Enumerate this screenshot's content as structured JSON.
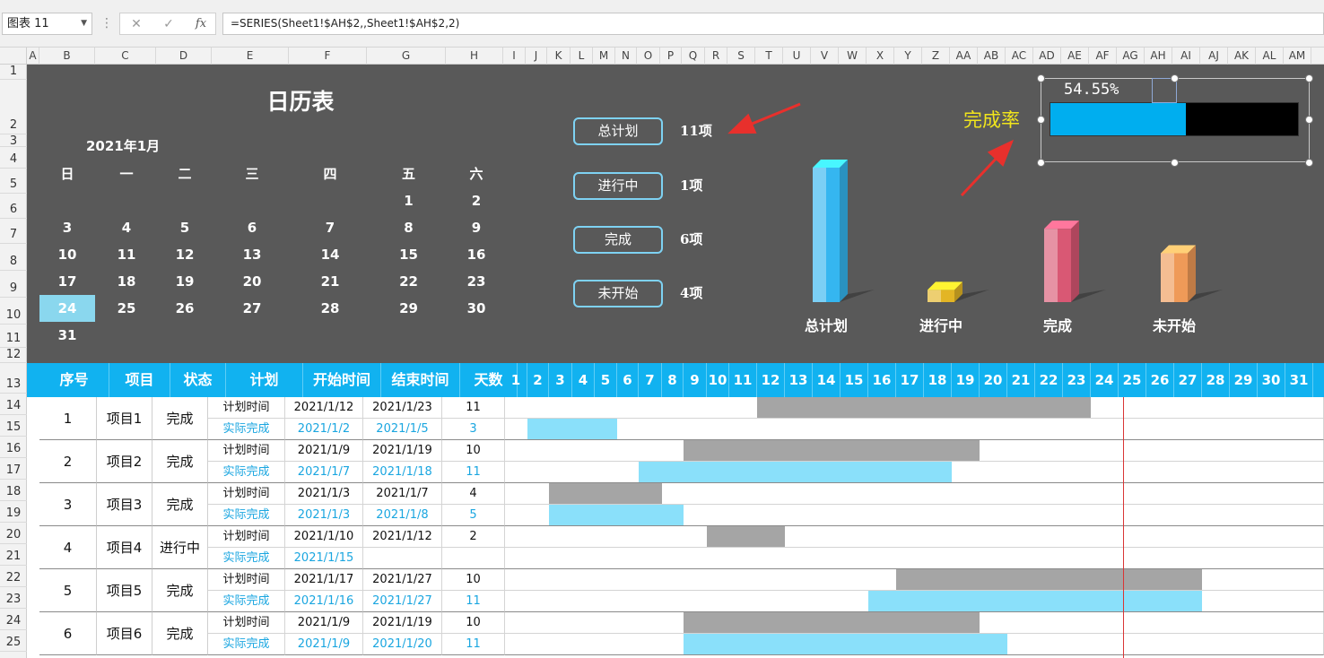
{
  "formula_bar": {
    "name_box": "图表 11",
    "formula": "=SERIES(Sheet1!$AH$2,,Sheet1!$AH$2,2)",
    "cancel_icon": "✕",
    "enter_icon": "✓",
    "fx_label": "fx"
  },
  "columns": [
    "A",
    "B",
    "C",
    "D",
    "E",
    "F",
    "G",
    "H",
    "I",
    "J",
    "K",
    "L",
    "M",
    "N",
    "O",
    "P",
    "Q",
    "R",
    "S",
    "T",
    "U",
    "V",
    "W",
    "X",
    "Y",
    "Z",
    "AA",
    "AB",
    "AC",
    "AD",
    "AE",
    "AF",
    "AG",
    "AH",
    "AI",
    "AJ",
    "AK",
    "AL",
    "AM"
  ],
  "rows": [
    "1",
    "2",
    "3",
    "4",
    "5",
    "6",
    "7",
    "8",
    "9",
    "10",
    "11",
    "12",
    "13",
    "14",
    "15",
    "16",
    "17",
    "18",
    "19",
    "20",
    "21",
    "22",
    "23",
    "24",
    "25"
  ],
  "calendar": {
    "title": "日历表",
    "month": "2021年1月",
    "weekdays": [
      "日",
      "一",
      "二",
      "三",
      "四",
      "五",
      "六"
    ],
    "weeks": [
      [
        "",
        "",
        "",
        "",
        "",
        "1",
        "2"
      ],
      [
        "3",
        "4",
        "5",
        "6",
        "7",
        "8",
        "9"
      ],
      [
        "10",
        "11",
        "12",
        "13",
        "14",
        "15",
        "16"
      ],
      [
        "17",
        "18",
        "19",
        "20",
        "21",
        "22",
        "23"
      ],
      [
        "24",
        "25",
        "26",
        "27",
        "28",
        "29",
        "30"
      ],
      [
        "31",
        "",
        "",
        "",
        "",
        "",
        ""
      ]
    ],
    "highlight": "24"
  },
  "stats": [
    {
      "label": "总计划",
      "value": "11项"
    },
    {
      "label": "进行中",
      "value": "1项"
    },
    {
      "label": "完成",
      "value": "6项"
    },
    {
      "label": "未开始",
      "value": "4项"
    }
  ],
  "chart_data": {
    "type": "bar",
    "categories": [
      "总计划",
      "进行中",
      "完成",
      "未开始"
    ],
    "values": [
      11,
      1,
      6,
      4
    ],
    "colors": [
      "#35b6f0",
      "#e3b525",
      "#d95874",
      "#ef9a58"
    ]
  },
  "completion": {
    "label": "完成率",
    "text": "54.55%",
    "value": 0.5455,
    "fill_color": "#00aeef"
  },
  "table_header": {
    "cols": [
      "序号",
      "项目",
      "状态",
      "计划",
      "开始时间",
      "结束时间",
      "天数"
    ],
    "days": [
      "1",
      "2",
      "3",
      "4",
      "5",
      "6",
      "7",
      "8",
      "9",
      "10",
      "11",
      "12",
      "13",
      "14",
      "15",
      "16",
      "17",
      "18",
      "19",
      "20",
      "21",
      "22",
      "23",
      "24",
      "25",
      "26",
      "27",
      "28",
      "29",
      "30",
      "31"
    ]
  },
  "projects": [
    {
      "no": "1",
      "name": "项目1",
      "status": "完成",
      "plan": {
        "label": "计划时间",
        "start": "2021/1/12",
        "end": "2021/1/23",
        "days": "11"
      },
      "actual": {
        "label": "实际完成",
        "start": "2021/1/2",
        "end": "2021/1/5",
        "days": "3"
      }
    },
    {
      "no": "2",
      "name": "项目2",
      "status": "完成",
      "plan": {
        "label": "计划时间",
        "start": "2021/1/9",
        "end": "2021/1/19",
        "days": "10"
      },
      "actual": {
        "label": "实际完成",
        "start": "2021/1/7",
        "end": "2021/1/18",
        "days": "11"
      }
    },
    {
      "no": "3",
      "name": "项目3",
      "status": "完成",
      "plan": {
        "label": "计划时间",
        "start": "2021/1/3",
        "end": "2021/1/7",
        "days": "4"
      },
      "actual": {
        "label": "实际完成",
        "start": "2021/1/3",
        "end": "2021/1/8",
        "days": "5"
      }
    },
    {
      "no": "4",
      "name": "项目4",
      "status": "进行中",
      "plan": {
        "label": "计划时间",
        "start": "2021/1/10",
        "end": "2021/1/12",
        "days": "2"
      },
      "actual": {
        "label": "实际完成",
        "start": "2021/1/15",
        "end": "",
        "days": ""
      }
    },
    {
      "no": "5",
      "name": "项目5",
      "status": "完成",
      "plan": {
        "label": "计划时间",
        "start": "2021/1/17",
        "end": "2021/1/27",
        "days": "10"
      },
      "actual": {
        "label": "实际完成",
        "start": "2021/1/16",
        "end": "2021/1/27",
        "days": "11"
      }
    },
    {
      "no": "6",
      "name": "项目6",
      "status": "完成",
      "plan": {
        "label": "计划时间",
        "start": "2021/1/9",
        "end": "2021/1/19",
        "days": "10"
      },
      "actual": {
        "label": "实际完成",
        "start": "2021/1/9",
        "end": "2021/1/20",
        "days": "11"
      }
    }
  ],
  "today": "24"
}
